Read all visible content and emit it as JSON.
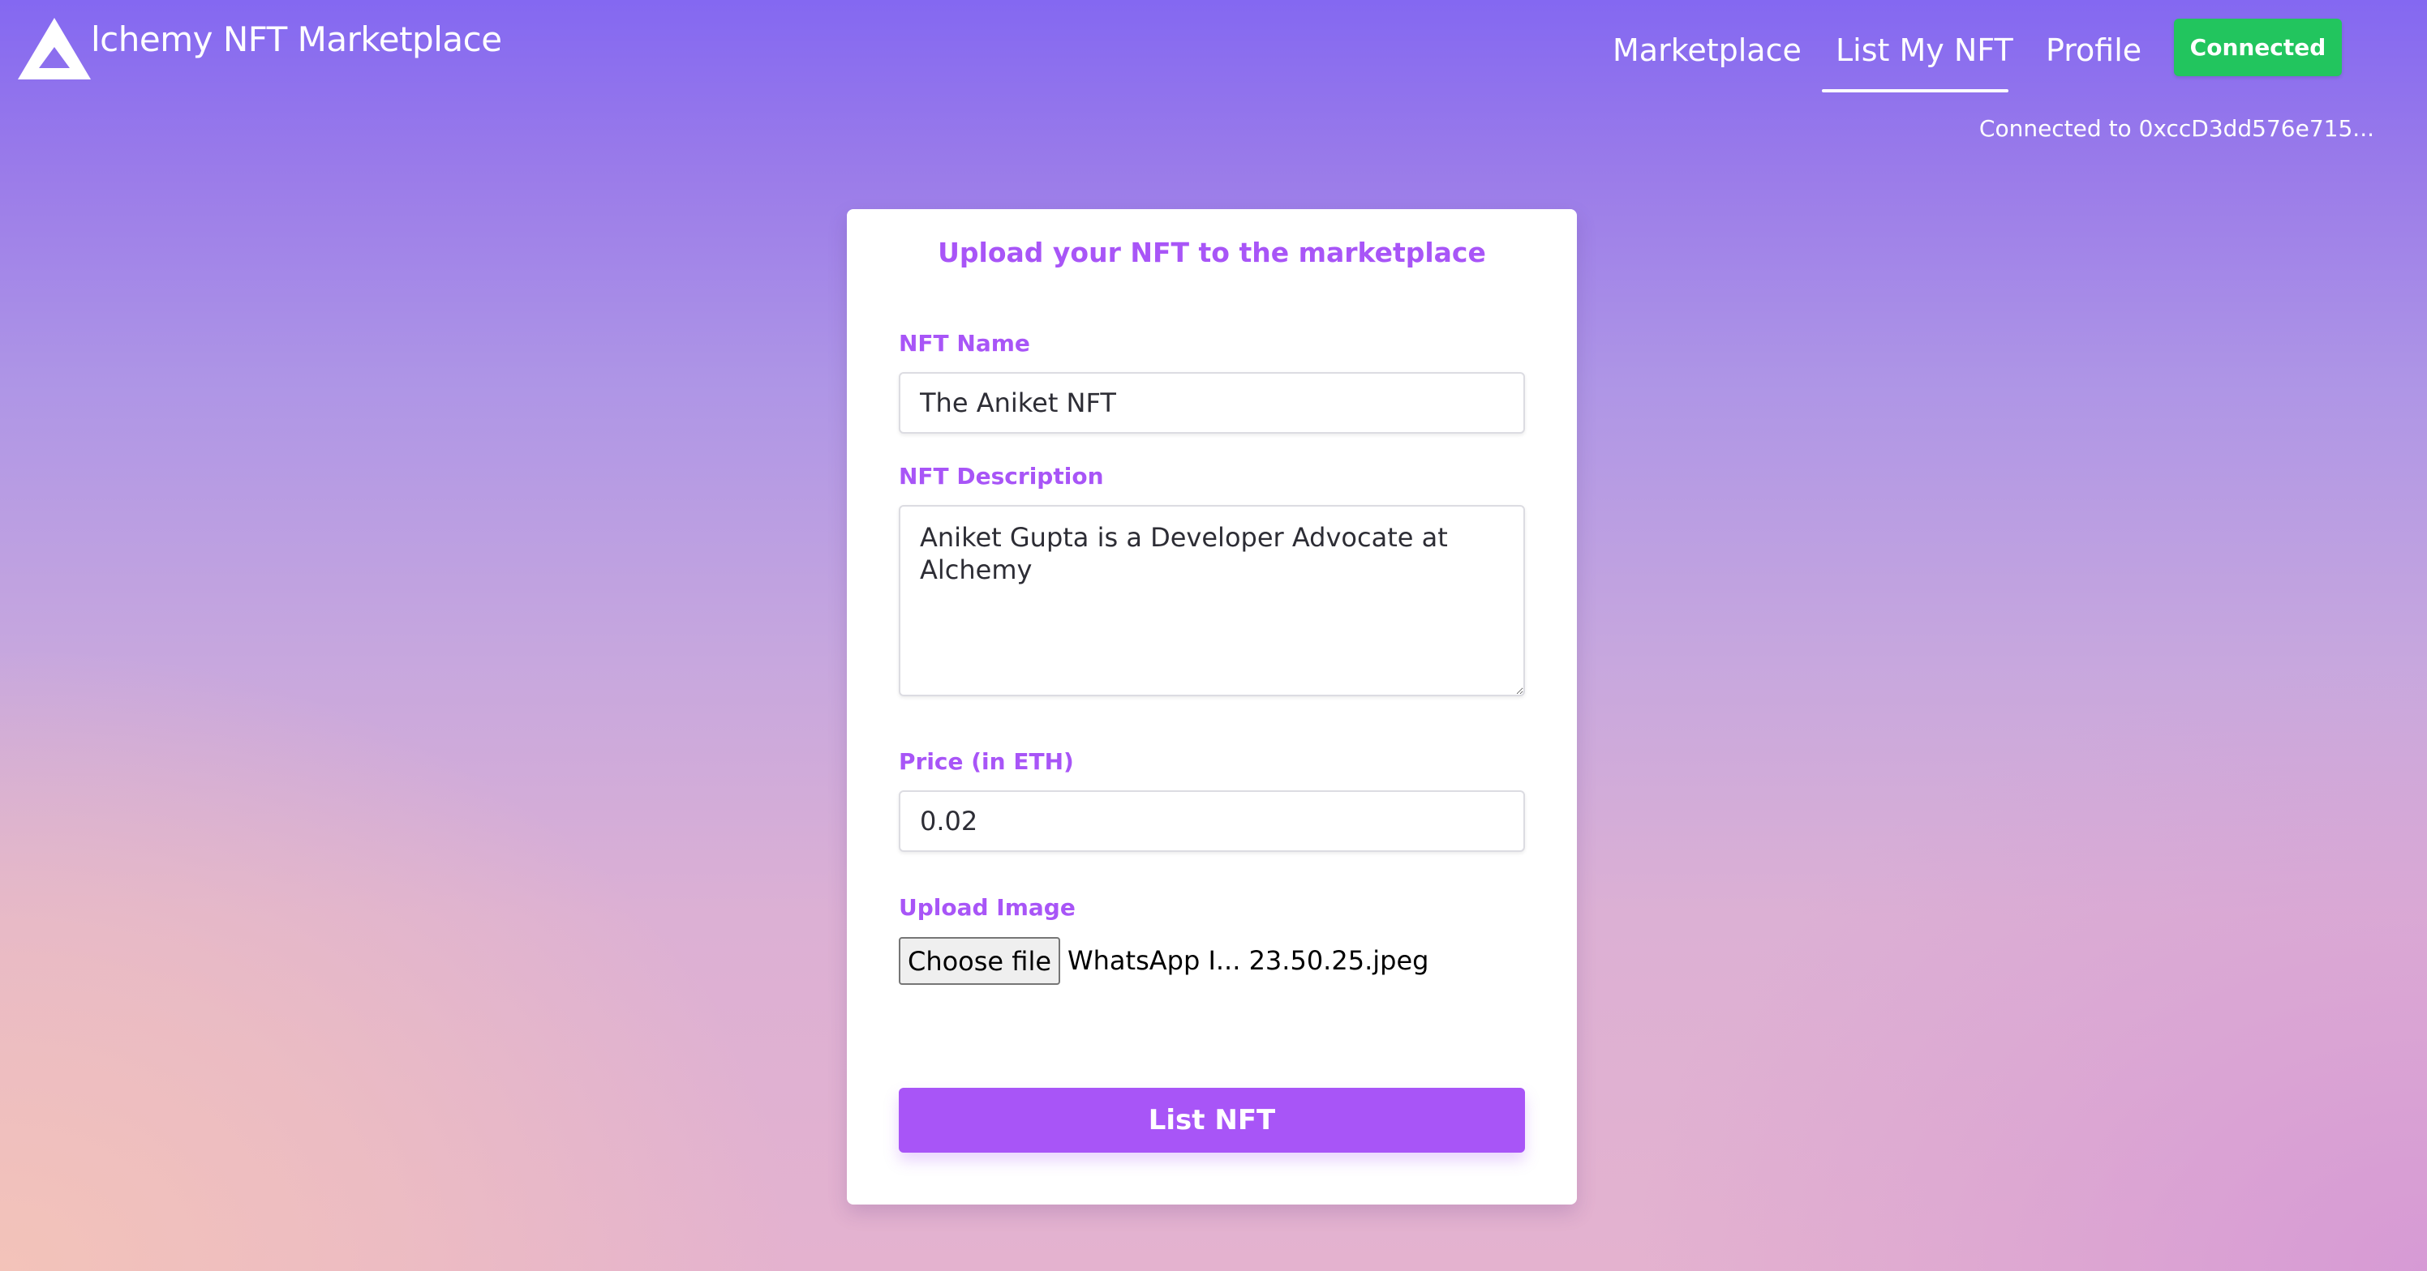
{
  "header": {
    "brand": "lchemy NFT Marketplace",
    "nav": {
      "marketplace": "Marketplace",
      "list_nft": "List My NFT",
      "profile": "Profile"
    },
    "connect_button": "Connected",
    "connected_address": "Connected to 0xccD3dd576e715..."
  },
  "form": {
    "title": "Upload your NFT to the marketplace",
    "name_label": "NFT Name",
    "name_value": "The Aniket NFT",
    "description_label": "NFT Description",
    "description_value": "Aniket Gupta is a Developer Advocate at Alchemy",
    "price_label": "Price (in ETH)",
    "price_value": "0.02",
    "image_label": "Upload Image",
    "choose_file_label": "Choose file",
    "file_name": "WhatsApp I... 23.50.25.jpeg",
    "submit_label": "List NFT"
  },
  "colors": {
    "accent": "#a855f7",
    "connected_green": "#22c55e",
    "background_top": "#8468f1",
    "background_bottom": "#e4b2cf"
  },
  "icons": {
    "logo": "alchemy-logo-icon"
  }
}
